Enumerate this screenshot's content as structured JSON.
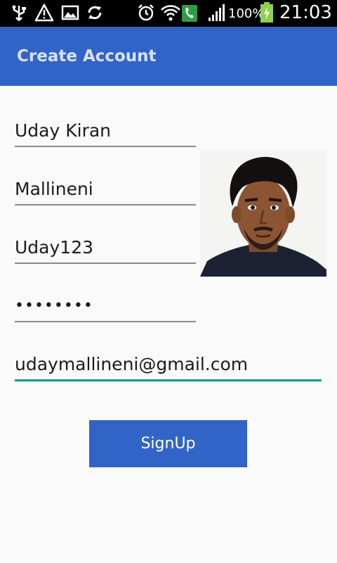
{
  "status_bar": {
    "icons": [
      "usb-icon",
      "warning-icon",
      "image-icon",
      "sync-icon",
      "alarm-icon",
      "wifi-icon",
      "phone-icon",
      "signal-icon",
      "battery-charging-icon"
    ],
    "battery": "100%",
    "time": "21:03"
  },
  "app_bar": {
    "title": "Create Account",
    "color": "#3264c8"
  },
  "form": {
    "first_name": "Uday Kiran",
    "last_name": "Mallineni",
    "username": "Uday123",
    "password": "••••••••",
    "email": "udaymallineni@gmail.com",
    "submit_label": "SignUp"
  },
  "colors": {
    "accent": "#119a8c",
    "primary": "#3264c8"
  }
}
